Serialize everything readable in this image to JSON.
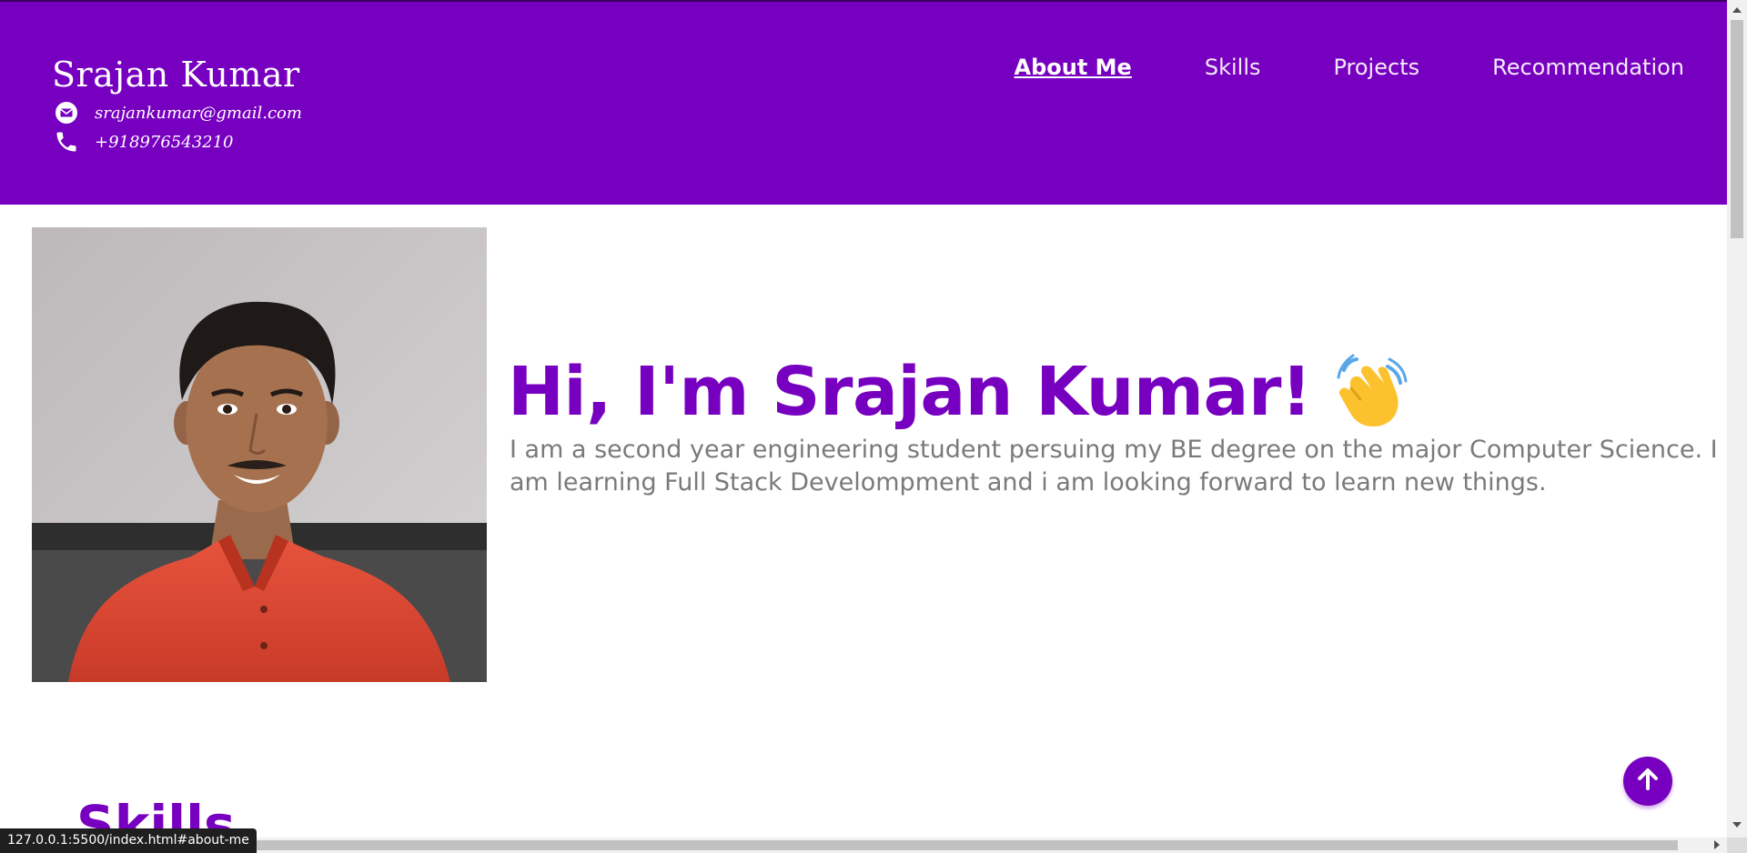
{
  "header": {
    "name": "Srajan Kumar",
    "email": "srajankumar@gmail.com",
    "phone": "+918976543210",
    "nav": [
      {
        "label": "About Me",
        "active": true
      },
      {
        "label": "Skills",
        "active": false
      },
      {
        "label": "Projects",
        "active": false
      },
      {
        "label": "Recommendation",
        "active": false
      }
    ]
  },
  "hero": {
    "title": "Hi, I'm Srajan Kumar!",
    "bio": "I am a second year engineering student persuing my BE degree on the major Computer Science. I am learning Full Stack Develompment and i am looking forward to learn new things."
  },
  "skills": {
    "title": "Skills"
  },
  "status_bar": {
    "url": "127.0.0.1:5500/index.html#about-me"
  },
  "colors": {
    "brand": "#7700c0",
    "text_muted": "#7a7a7a",
    "header_text": "#ffffff"
  },
  "icons": {
    "email": "envelope-icon",
    "phone": "phone-icon",
    "wave": "waving-hand-icon",
    "scroll_top": "arrow-up-icon"
  }
}
